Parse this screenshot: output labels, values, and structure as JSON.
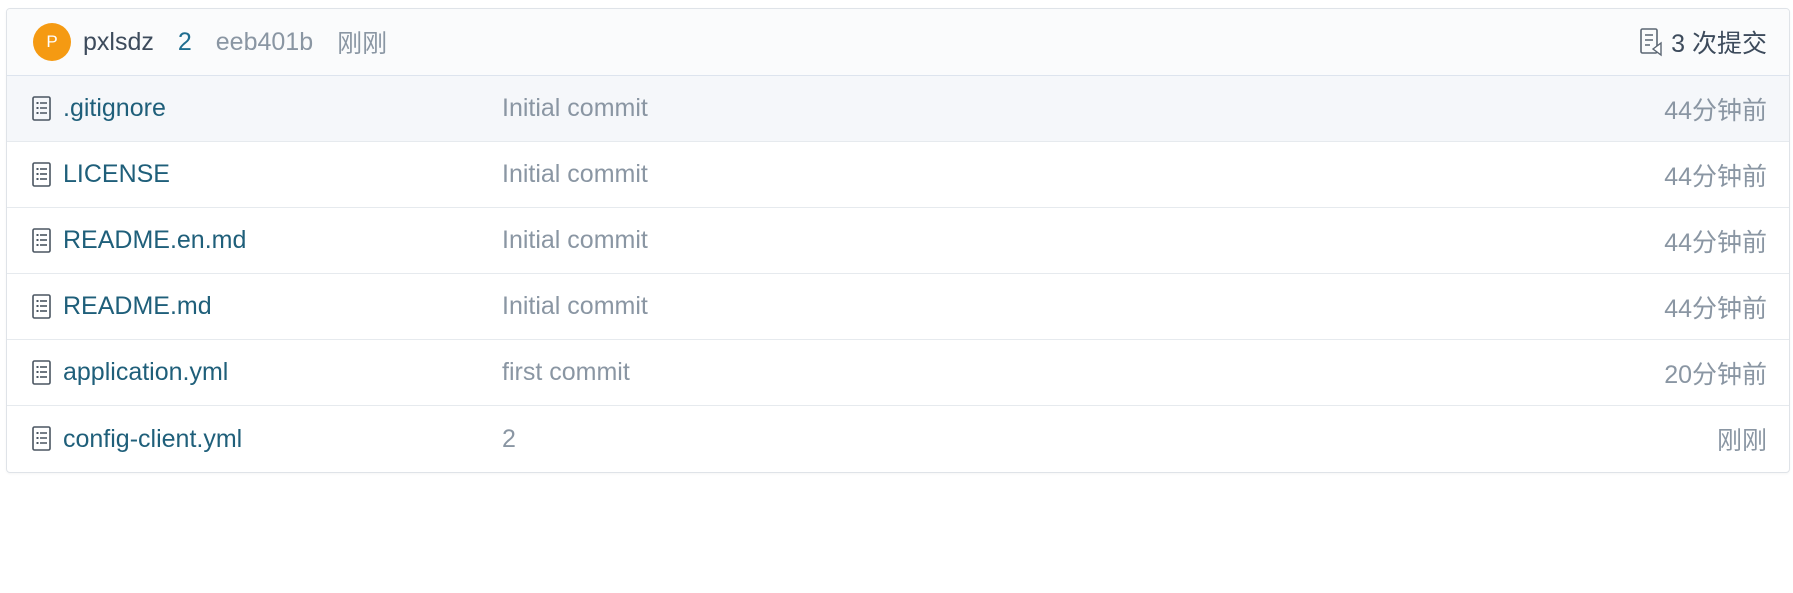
{
  "latest_commit": {
    "avatar_letter": "P",
    "avatar_color": "#f59a12",
    "author": "pxlsdz",
    "message": "2",
    "sha": "eeb401b",
    "time": "刚刚",
    "commits_label": "3 次提交",
    "commits_icon": "commit-list-icon"
  },
  "files": [
    {
      "name": ".gitignore",
      "commit": "Initial commit",
      "time": "44分钟前",
      "icon": "file-icon"
    },
    {
      "name": "LICENSE",
      "commit": "Initial commit",
      "time": "44分钟前",
      "icon": "file-icon"
    },
    {
      "name": "README.en.md",
      "commit": "Initial commit",
      "time": "44分钟前",
      "icon": "file-icon"
    },
    {
      "name": "README.md",
      "commit": "Initial commit",
      "time": "44分钟前",
      "icon": "file-icon"
    },
    {
      "name": "application.yml",
      "commit": "first commit",
      "time": "20分钟前",
      "icon": "file-icon"
    },
    {
      "name": "config-client.yml",
      "commit": "2",
      "time": "刚刚",
      "icon": "file-icon"
    }
  ],
  "colors": {
    "link": "#1f5f7a",
    "muted": "#8a96a3",
    "header_bg": "#fafbfc",
    "active_row_bg": "#f5f7fa"
  }
}
